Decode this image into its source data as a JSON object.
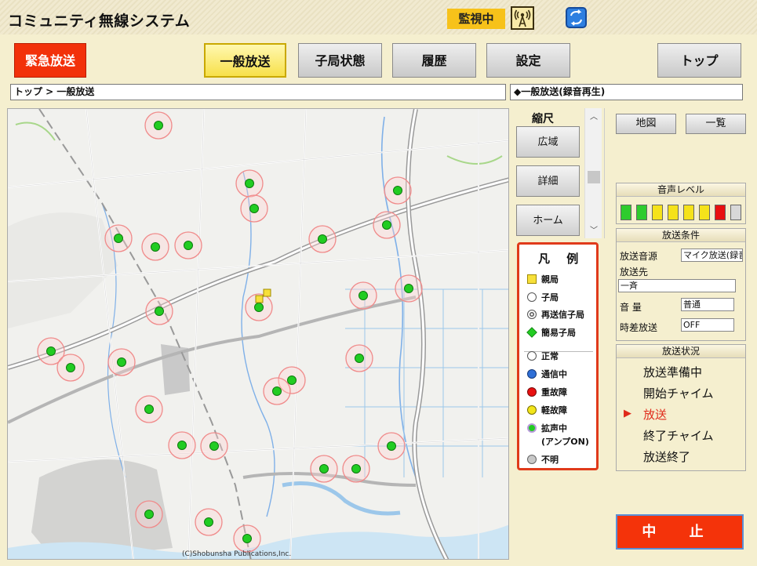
{
  "app": {
    "title": "コミュニティ無線システム",
    "monitor_status": "監視中"
  },
  "icons": {
    "antenna": "antenna-signal-icon",
    "sync": "sync-icon"
  },
  "nav": {
    "emergency": "緊急放送",
    "general": "一般放送",
    "station_status": "子局状態",
    "history": "履歴",
    "settings": "設定",
    "top": "トップ"
  },
  "breadcrumb": "トップ > 一般放送",
  "panel_title": "◆一般放送(録音再生)",
  "scale": {
    "title": "縮尺",
    "wide": "広域",
    "detail": "詳細",
    "home": "ホーム"
  },
  "view_buttons": {
    "map": "地図",
    "list": "一覧"
  },
  "legend": {
    "title": "凡 例",
    "items": [
      {
        "label": "親局",
        "symbol": "yellow-square"
      },
      {
        "label": "子局",
        "symbol": "circle"
      },
      {
        "label": "再送信子局",
        "symbol": "double-circle"
      },
      {
        "label": "簡易子局",
        "symbol": "green-diamond"
      },
      {
        "label": "正常",
        "symbol": "white-circle"
      },
      {
        "label": "通信中",
        "symbol": "blue-circle"
      },
      {
        "label": "重故障",
        "symbol": "red-circle"
      },
      {
        "label": "軽故障",
        "symbol": "yellow-circle"
      },
      {
        "label": "拡声中",
        "symbol": "green-ringed-circle"
      },
      {
        "label": "(アンプON)",
        "symbol": ""
      },
      {
        "label": "不明",
        "symbol": "gray-circle"
      }
    ],
    "colors": {
      "parent": "#f7e03a",
      "normal": "#ffffff",
      "communicating": "#2f6fd6",
      "major_fault": "#e81010",
      "minor_fault": "#f2e51a",
      "speaking": "#22cc22",
      "unknown": "#c8c8c8"
    }
  },
  "volume_level": {
    "title": "音声レベル",
    "segments": [
      "green",
      "green",
      "yellow",
      "yellow",
      "yellow",
      "yellow",
      "red",
      "gray"
    ]
  },
  "conditions": {
    "title": "放送条件",
    "source_label": "放送音源",
    "source_value": "マイク放送(録音",
    "destination_label": "放送先",
    "destination_value": "一斉",
    "volume_label": "音 量",
    "volume_value": "普通",
    "delay_label": "時差放送",
    "delay_value": "OFF"
  },
  "status": {
    "title": "放送状況",
    "stages": [
      "放送準備中",
      "開始チャイム",
      "放送",
      "終了チャイム",
      "放送終了"
    ],
    "current_index": 2
  },
  "stop_button": "中 止",
  "map": {
    "copyright": "(C)Shobunsha Publications,Inc.",
    "station_status": "speaking",
    "station_count": 30
  }
}
